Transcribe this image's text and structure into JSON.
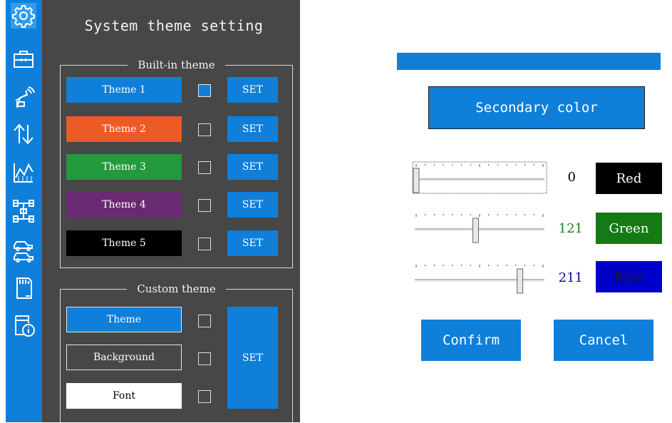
{
  "left": {
    "title": "System theme setting",
    "builtin": {
      "legend": "Built-in theme",
      "themes": [
        {
          "label": "Theme 1",
          "color": "#0f7fd9",
          "checked": true
        },
        {
          "label": "Theme 2",
          "color": "#ec5b25",
          "checked": false
        },
        {
          "label": "Theme 3",
          "color": "#239a3e",
          "checked": false
        },
        {
          "label": "Theme 4",
          "color": "#682a70",
          "checked": false
        },
        {
          "label": "Theme 5",
          "color": "#000000",
          "checked": false
        }
      ],
      "set_label": "SET"
    },
    "custom": {
      "legend": "Custom theme",
      "items": [
        {
          "label": "Theme",
          "bg": "#0f7fd9",
          "fg": "#ffffff"
        },
        {
          "label": "Background",
          "bg": "#474747",
          "fg": "#ffffff"
        },
        {
          "label": "Font",
          "bg": "#ffffff",
          "fg": "#000000"
        }
      ],
      "set_label": "SET"
    },
    "sidebar_icons": [
      "gear-icon",
      "toolbox-icon",
      "remote-control-icon",
      "up-down-arrows-icon",
      "chart-icon",
      "chassis-icon",
      "vehicle-swap-icon",
      "sd-card-icon",
      "info-icon"
    ],
    "colors": {
      "panel_bg": "#474747",
      "accent": "#0f7fd9"
    }
  },
  "dialog": {
    "title": "Secondary color",
    "sliders": [
      {
        "name": "Red",
        "value": "0",
        "value_color": "#000000",
        "label_bg": "#000000",
        "label_fg": "#ffffff",
        "level": 0
      },
      {
        "name": "Green",
        "value": "121",
        "value_color": "#1e7d1e",
        "label_bg": "#157a15",
        "label_fg": "#ffffff",
        "level": 121
      },
      {
        "name": "Blue",
        "value": "211",
        "value_color": "#0a0aa0",
        "label_bg": "#0000c8",
        "label_fg": "#1a1a1a",
        "level": 211
      }
    ],
    "max_value": 255,
    "confirm_label": "Confirm",
    "cancel_label": "Cancel"
  }
}
